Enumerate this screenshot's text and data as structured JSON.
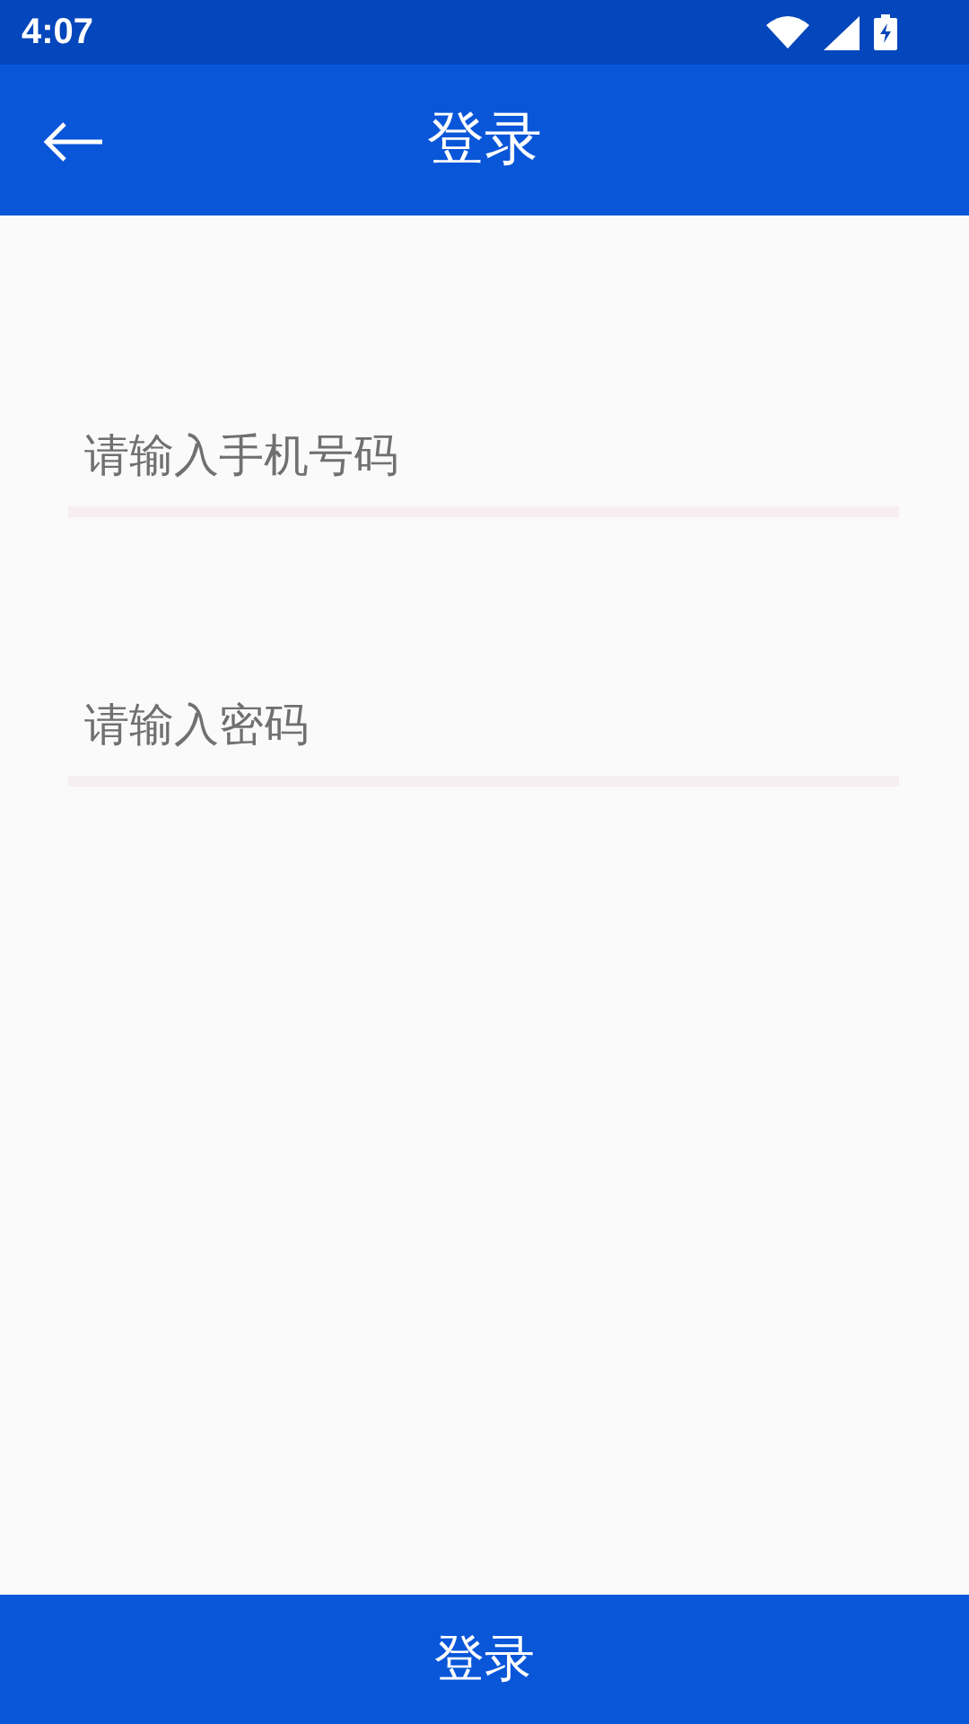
{
  "status_bar": {
    "time": "4:07"
  },
  "app_bar": {
    "title": "登录"
  },
  "fields": [
    {
      "placeholder": "请输入手机号码"
    },
    {
      "placeholder": "请输入密码"
    }
  ],
  "login_button": {
    "label": "登录"
  }
}
